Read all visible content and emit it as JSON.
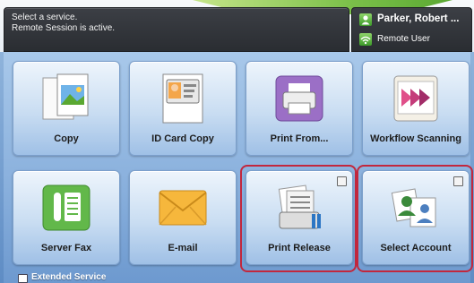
{
  "status": {
    "line1": "Select a service.",
    "line2": "Remote Session is active."
  },
  "user": {
    "name": "Parker, Robert ...",
    "role": "Remote User",
    "icon": "user-icon",
    "role_icon": "remote-icon"
  },
  "tiles": [
    {
      "label": "Copy",
      "icon": "copy-icon",
      "highlighted": false
    },
    {
      "label": "ID Card Copy",
      "icon": "id-card-icon",
      "highlighted": false
    },
    {
      "label": "Print From...",
      "icon": "printer-icon",
      "highlighted": false
    },
    {
      "label": "Workflow Scanning",
      "icon": "workflow-scan-icon",
      "highlighted": false
    },
    {
      "label": "Server Fax",
      "icon": "fax-icon",
      "highlighted": false
    },
    {
      "label": "E-mail",
      "icon": "envelope-icon",
      "highlighted": false
    },
    {
      "label": "Print Release",
      "icon": "print-release-icon",
      "highlighted": true
    },
    {
      "label": "Select Account",
      "icon": "select-account-icon",
      "highlighted": true
    }
  ],
  "footer": {
    "extended_label": "Extended Service"
  },
  "colors": {
    "highlight": "#c2273d",
    "status_bg": "#2f3237",
    "accent_green": "#5aa832"
  }
}
